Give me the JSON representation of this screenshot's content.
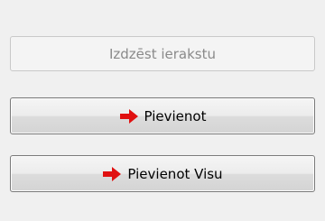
{
  "buttons": {
    "delete_record": {
      "label": "Izdzēst ierakstu",
      "enabled": false
    },
    "add": {
      "label": "Pievienot",
      "icon": "arrow-right-icon",
      "icon_color": "#e01010"
    },
    "add_all": {
      "label": "Pievienot Visu",
      "icon": "arrow-right-icon",
      "icon_color": "#e01010"
    }
  }
}
